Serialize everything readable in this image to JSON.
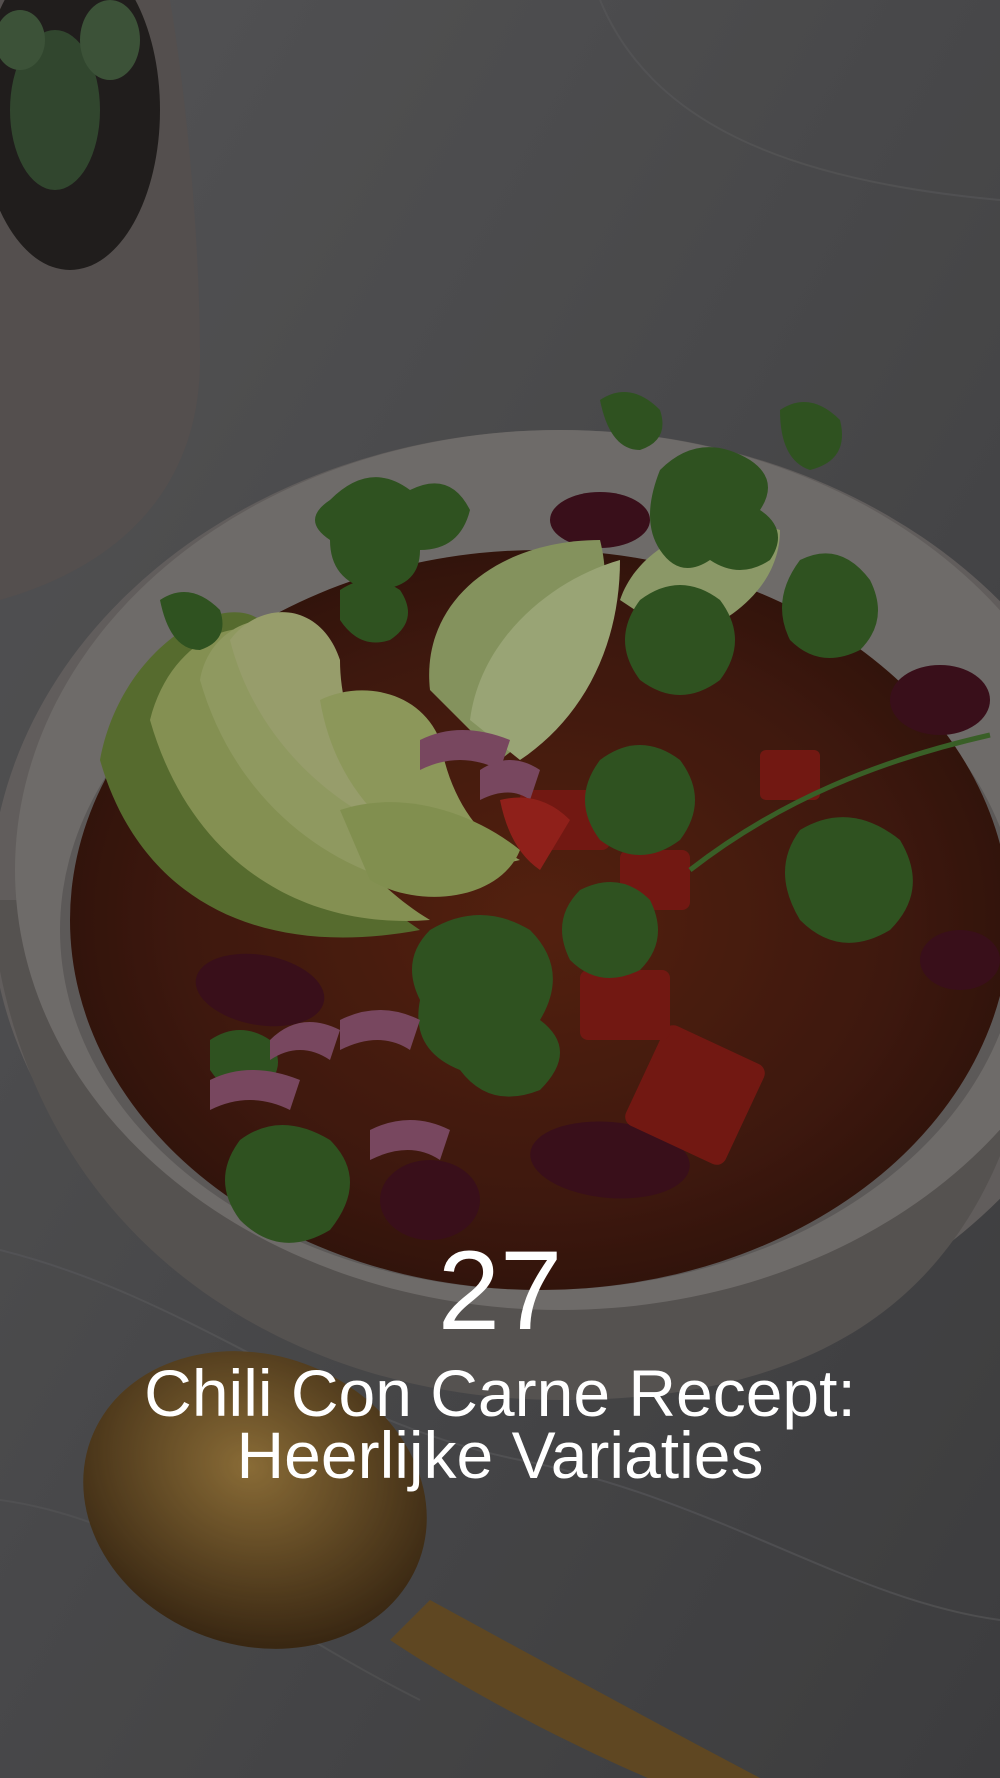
{
  "pin": {
    "number": "27",
    "title_line_1": "Chili Con Carne Recept:",
    "title_line_2": "Heerlijke Variaties"
  },
  "photo": {
    "subject": "bowl-of-chili-con-carne",
    "colors": {
      "marble": "#5f5f61",
      "bowl": "#8a8582",
      "chili": "#5a2414",
      "avocado": "#a4b86a",
      "cilantro": "#3f6b2c",
      "lime": "#b9c98a",
      "onion": "#a86a86",
      "pepper": "#a2261e",
      "spoon": "#8a6a34"
    }
  }
}
